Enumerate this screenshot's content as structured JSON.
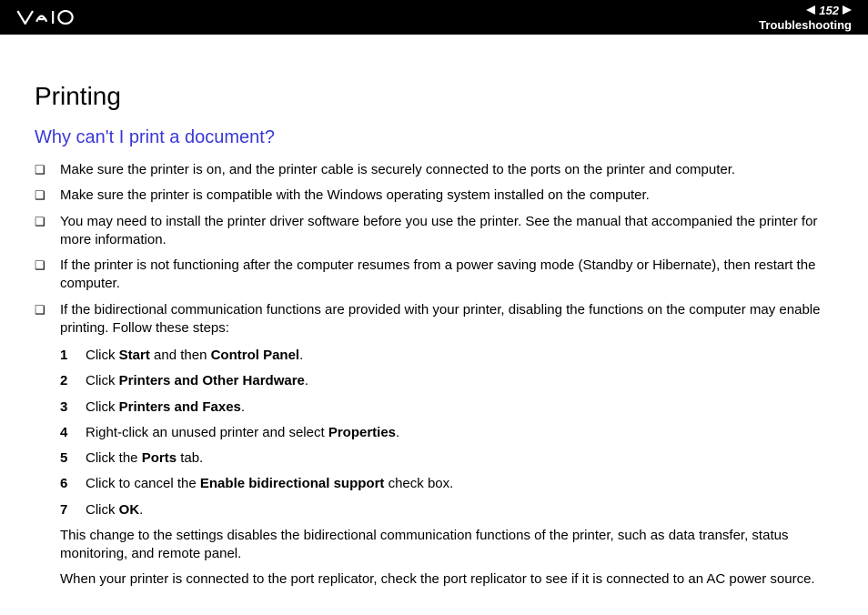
{
  "header": {
    "page_number": "152",
    "section": "Troubleshooting"
  },
  "title": "Printing",
  "question": "Why can't I print a document?",
  "bullets": [
    "Make sure the printer is on, and the printer cable is securely connected to the ports on the printer and computer.",
    "Make sure the printer is compatible with the Windows operating system installed on the computer.",
    "You may need to install the printer driver software before you use the printer. See the manual that accompanied the printer for more information.",
    "If the printer is not functioning after the computer resumes from a power saving mode (Standby or Hibernate), then restart the computer.",
    "If the bidirectional communication functions are provided with your printer, disabling the functions on the computer may enable printing. Follow these steps:"
  ],
  "steps": [
    {
      "n": "1",
      "pre": "Click ",
      "b1": "Start",
      "mid": " and then ",
      "b2": "Control Panel",
      "post": "."
    },
    {
      "n": "2",
      "pre": "Click ",
      "b1": "Printers and Other Hardware",
      "mid": "",
      "b2": "",
      "post": "."
    },
    {
      "n": "3",
      "pre": "Click ",
      "b1": "Printers and Faxes",
      "mid": "",
      "b2": "",
      "post": "."
    },
    {
      "n": "4",
      "pre": "Right-click an unused printer and select ",
      "b1": "Properties",
      "mid": "",
      "b2": "",
      "post": "."
    },
    {
      "n": "5",
      "pre": "Click the ",
      "b1": "Ports",
      "mid": "",
      "b2": "",
      "post": " tab."
    },
    {
      "n": "6",
      "pre": "Click to cancel the ",
      "b1": "Enable bidirectional support",
      "mid": "",
      "b2": "",
      "post": " check box."
    },
    {
      "n": "7",
      "pre": "Click ",
      "b1": "OK",
      "mid": "",
      "b2": "",
      "post": "."
    }
  ],
  "closing": [
    "This change to the settings disables the bidirectional communication functions of the printer, such as data transfer, status monitoring, and remote panel.",
    "When your printer is connected to the port replicator, check the port replicator to see if it is connected to an AC power source."
  ]
}
